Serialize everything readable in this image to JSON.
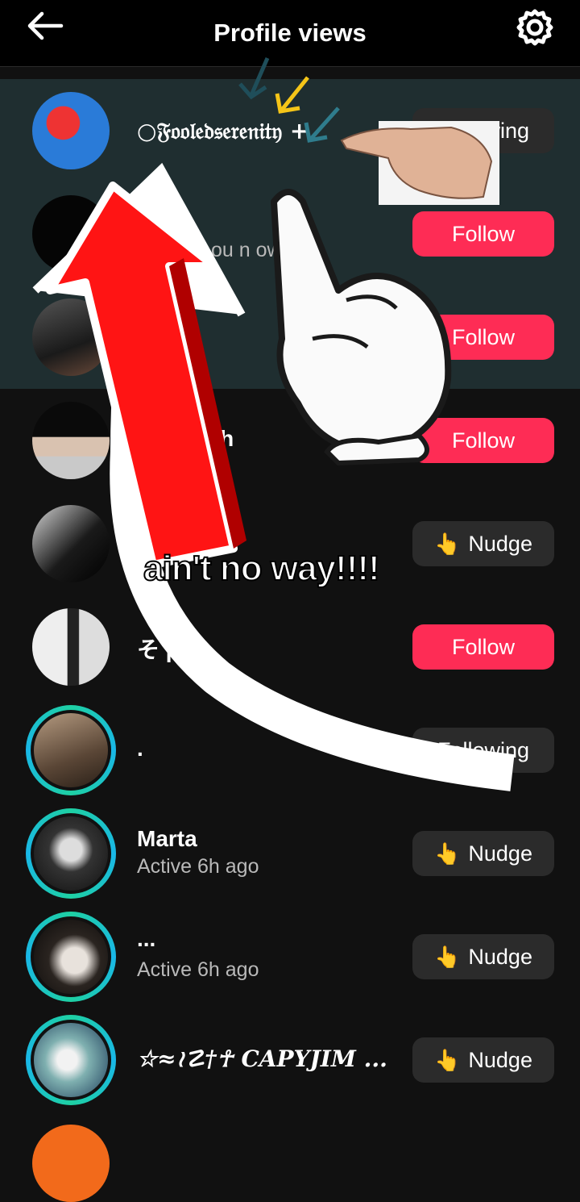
{
  "header": {
    "title": "Profile views"
  },
  "rows": [
    {
      "name": "○𝔉𝔬𝔬𝔩𝔢𝔡𝔰𝔢𝔯𝔢𝔫𝔦𝔱𝔶 +",
      "sub": "",
      "button": "Following",
      "type": "following"
    },
    {
      "name": "",
      "sub": "ou n      ow",
      "button": "Follow",
      "type": "follow"
    },
    {
      "name": "ng",
      "sub": "",
      "button": "Follow",
      "type": "follow"
    },
    {
      "name": "nh",
      "sub": "",
      "button": "Follow",
      "type": "follow"
    },
    {
      "name": "",
      "sub": "",
      "button": "Nudge",
      "type": "nudge"
    },
    {
      "name": "そ p",
      "sub": "",
      "button": "Follow",
      "type": "follow"
    },
    {
      "name": ".",
      "sub": "",
      "button": "Following",
      "type": "following"
    },
    {
      "name": "Marta",
      "sub": "Active 6h ago",
      "button": "Nudge",
      "type": "nudge"
    },
    {
      "name": "...",
      "sub": "Active 6h ago",
      "button": "Nudge",
      "type": "nudge"
    },
    {
      "name": "☆≈≀☡†☥ CAPYJIM ...",
      "sub": "",
      "button": "Nudge",
      "type": "nudge"
    }
  ],
  "overlay": {
    "caption": "ain't no way!!!!"
  },
  "colors": {
    "follow": "#fe2c55",
    "secondary_button": "#2b2b2b",
    "highlight_bg": "#1f2e30",
    "ring": "#1ed0a3"
  },
  "icons": {
    "back": "arrow-left-icon",
    "settings": "gear-icon",
    "nudge": "pointing-hand-icon"
  }
}
